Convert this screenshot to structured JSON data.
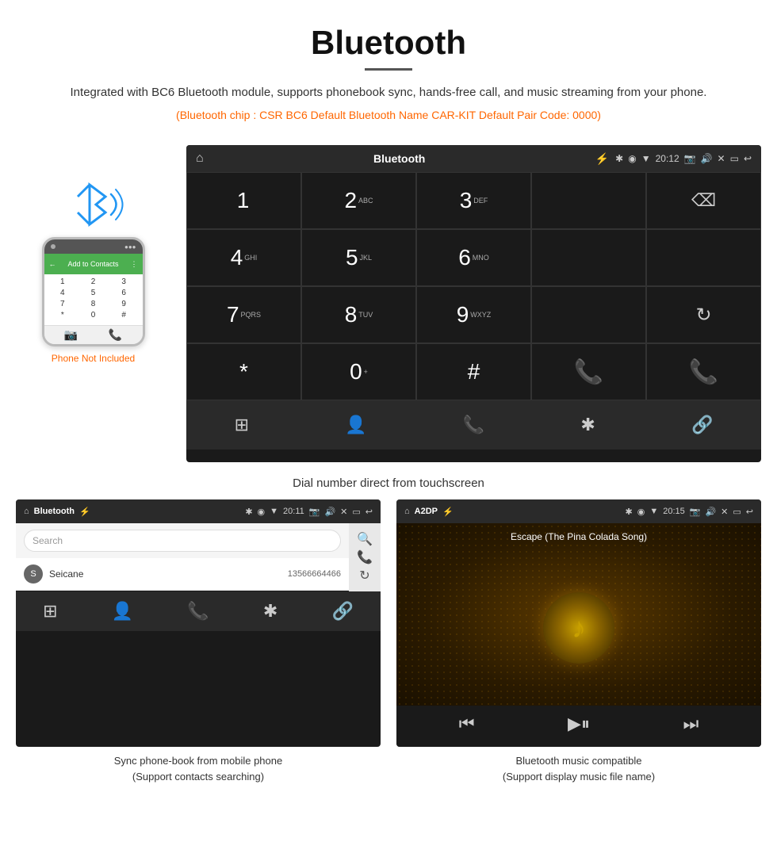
{
  "header": {
    "title": "Bluetooth",
    "description": "Integrated with BC6 Bluetooth module, supports phonebook sync, hands-free call, and music streaming from your phone.",
    "specs": "(Bluetooth chip : CSR BC6    Default Bluetooth Name CAR-KIT    Default Pair Code: 0000)"
  },
  "phone": {
    "not_included": "Phone Not Included"
  },
  "large_screen": {
    "title": "Bluetooth",
    "time": "20:12",
    "keys": [
      {
        "main": "1",
        "sub": ""
      },
      {
        "main": "2",
        "sub": "ABC"
      },
      {
        "main": "3",
        "sub": "DEF"
      },
      {
        "main": "4",
        "sub": "GHI"
      },
      {
        "main": "5",
        "sub": "JKL"
      },
      {
        "main": "6",
        "sub": "MNO"
      },
      {
        "main": "7",
        "sub": "PQRS"
      },
      {
        "main": "8",
        "sub": "TUV"
      },
      {
        "main": "9",
        "sub": "WXYZ"
      },
      {
        "main": "*",
        "sub": ""
      },
      {
        "main": "0",
        "sub": "+"
      },
      {
        "main": "#",
        "sub": ""
      }
    ]
  },
  "caption": "Dial number direct from touchscreen",
  "phonebook_panel": {
    "title": "Bluetooth",
    "time": "20:11",
    "search_placeholder": "Search",
    "contact": {
      "initial": "S",
      "name": "Seicane",
      "number": "13566664466"
    }
  },
  "music_panel": {
    "title": "A2DP",
    "time": "20:15",
    "song_title": "Escape (The Pina Colada Song)"
  },
  "bottom_captions": {
    "phonebook": "Sync phone-book from mobile phone\n(Support contacts searching)",
    "music": "Bluetooth music compatible\n(Support display music file name)"
  }
}
